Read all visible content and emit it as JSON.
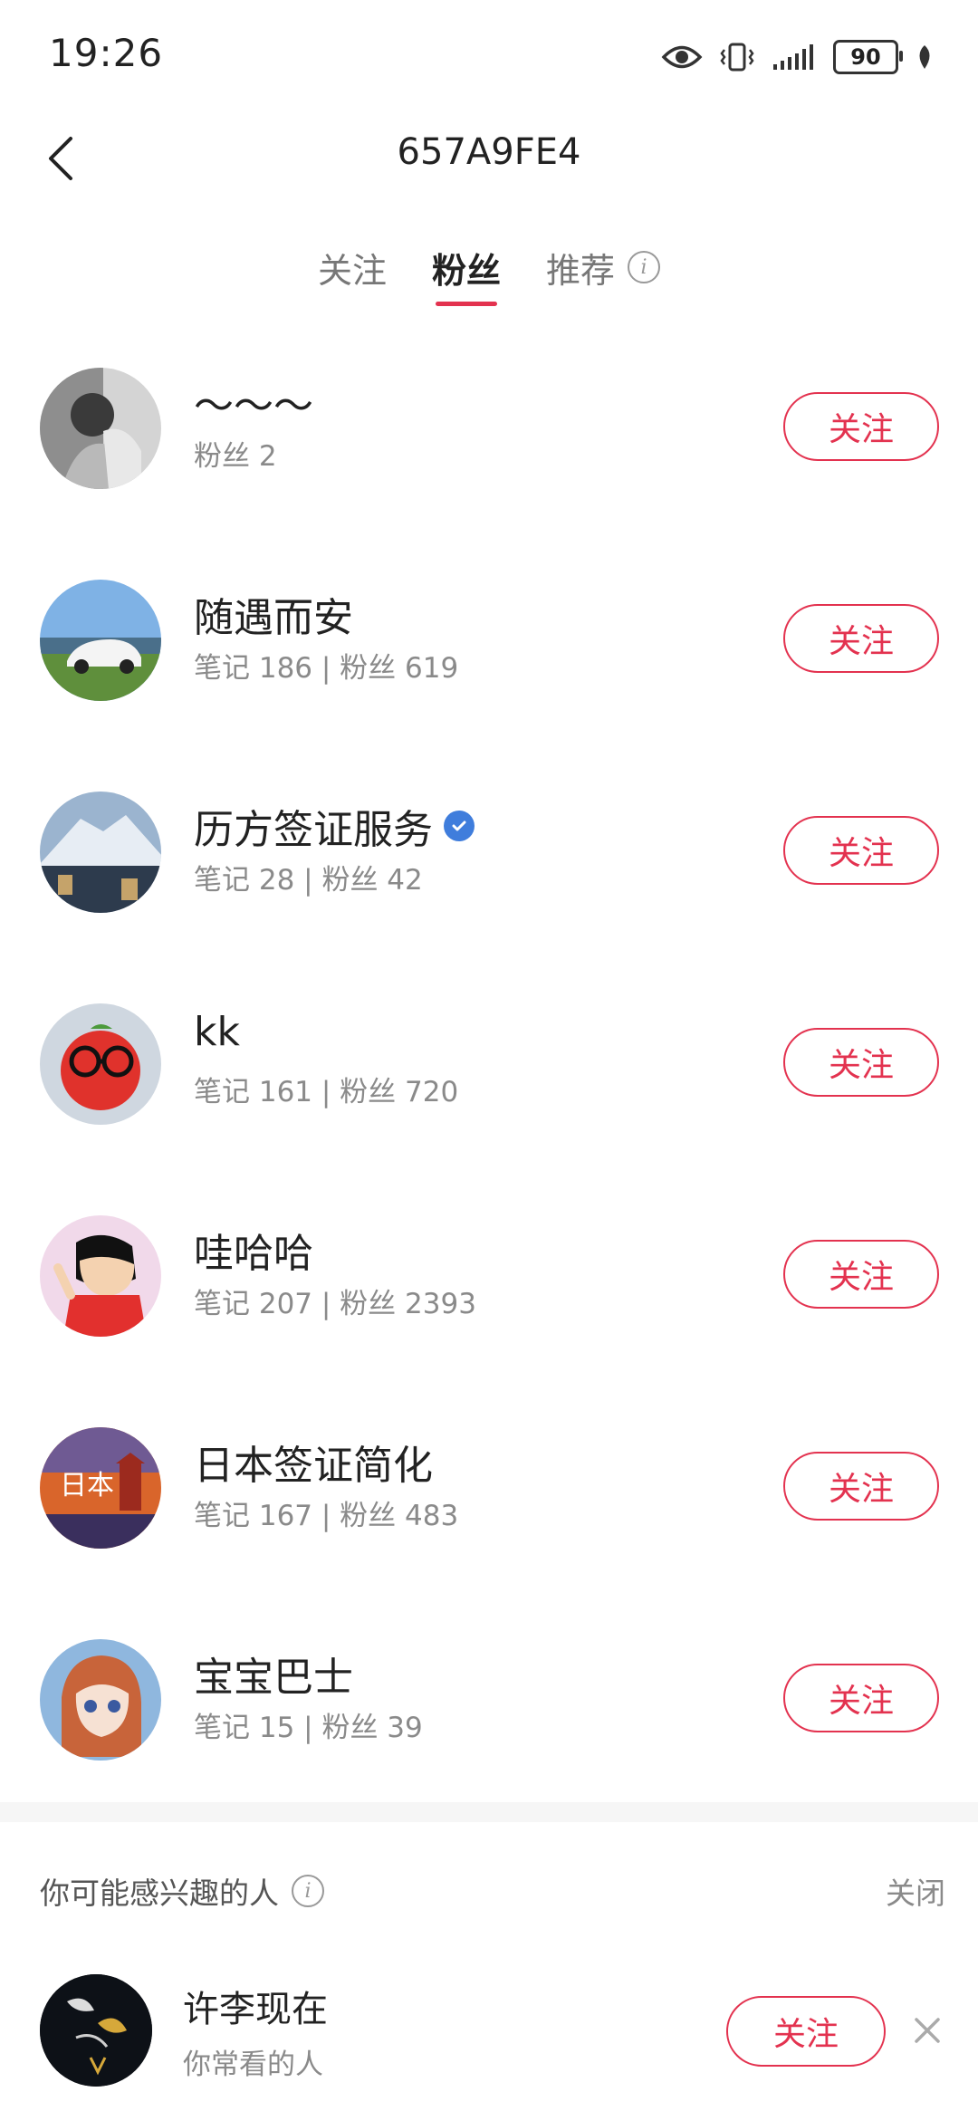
{
  "status": {
    "time": "19:26",
    "battery": "90"
  },
  "header": {
    "title": "657A9FE4"
  },
  "tabs": [
    {
      "label": "关注",
      "active": false
    },
    {
      "label": "粉丝",
      "active": true
    },
    {
      "label": "推荐",
      "active": false
    }
  ],
  "colors": {
    "accent": "#e3324f",
    "verified": "#3f7ddc",
    "muted": "#8a8a8a"
  },
  "users": [
    {
      "name": "～～～",
      "stats": "粉丝 2",
      "follow_label": "关注",
      "verified": false
    },
    {
      "name": "随遇而安",
      "stats": "笔记 186 | 粉丝 619",
      "follow_label": "关注",
      "verified": false
    },
    {
      "name": "历方签证服务",
      "stats": "笔记 28 | 粉丝 42",
      "follow_label": "关注",
      "verified": true
    },
    {
      "name": "kk",
      "stats": "笔记 161 | 粉丝 720",
      "follow_label": "关注",
      "verified": false
    },
    {
      "name": "哇哈哈",
      "stats": "笔记 207 | 粉丝 2393",
      "follow_label": "关注",
      "verified": false
    },
    {
      "name": "日本签证简化",
      "stats": "笔记 167 | 粉丝 483",
      "follow_label": "关注",
      "verified": false
    },
    {
      "name": "宝宝巴士",
      "stats": "笔记 15 | 粉丝 39",
      "follow_label": "关注",
      "verified": false
    }
  ],
  "suggestions": {
    "title": "你可能感兴趣的人",
    "close_label": "关闭",
    "item": {
      "name": "许李现在",
      "reason": "你常看的人",
      "follow_label": "关注"
    }
  }
}
